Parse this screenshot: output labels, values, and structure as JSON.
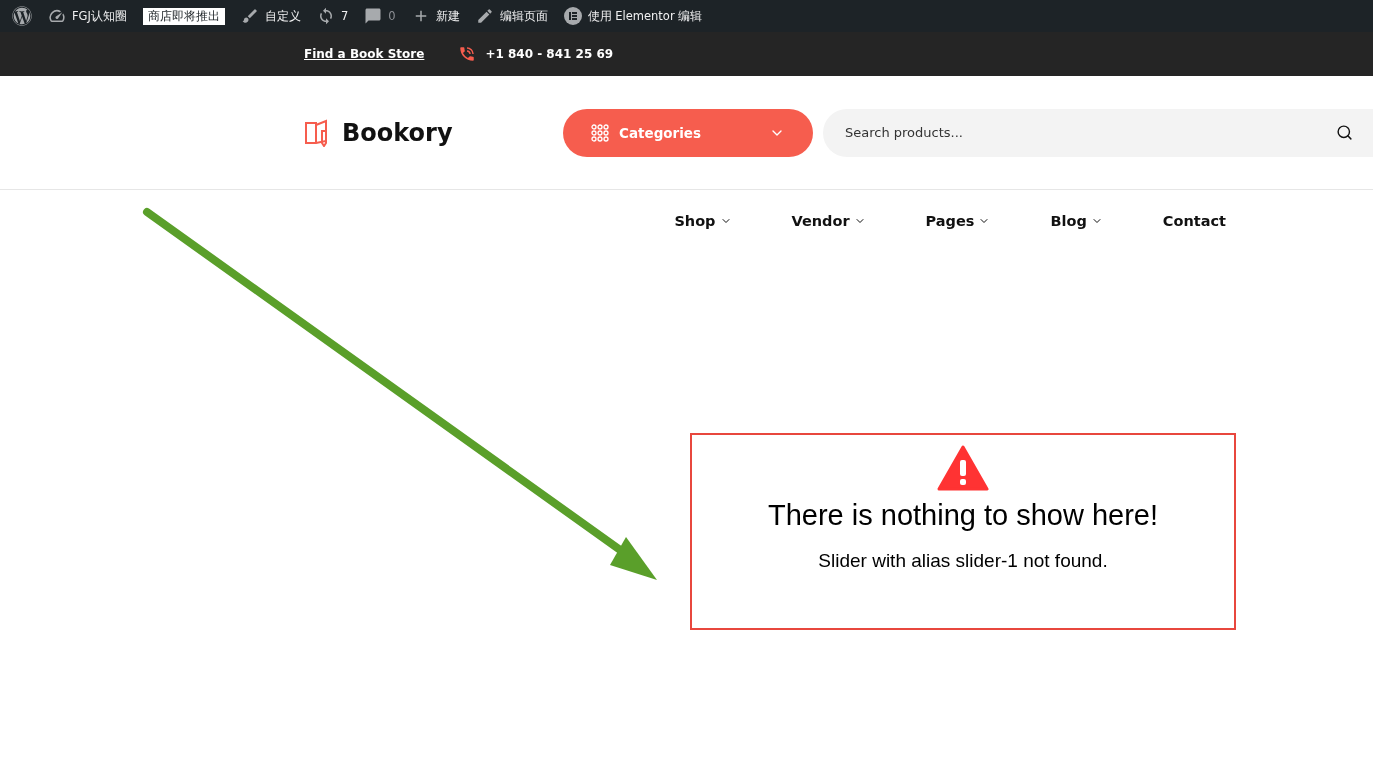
{
  "admin_bar": {
    "items": [
      {
        "kind": "wp"
      },
      {
        "kind": "dashboard",
        "label": "FGJ认知圈"
      },
      {
        "kind": "badge",
        "label": "商店即将推出"
      },
      {
        "kind": "brush",
        "label": "自定义"
      },
      {
        "kind": "updates",
        "label": "7"
      },
      {
        "kind": "comments",
        "label": "0",
        "disabled": true
      },
      {
        "kind": "new",
        "label": "新建"
      },
      {
        "kind": "edit",
        "label": "编辑页面"
      },
      {
        "kind": "elementor",
        "label": "使用 Elementor 编辑"
      }
    ]
  },
  "topbar": {
    "store_link": "Find a Book Store",
    "phone": "+1 840 - 841 25 69"
  },
  "header": {
    "logo": "Bookory",
    "categories": "Categories",
    "search": {
      "placeholder": "Search products..."
    }
  },
  "nav": [
    {
      "label": "Shop",
      "has_menu": true
    },
    {
      "label": "Vendor",
      "has_menu": true
    },
    {
      "label": "Pages",
      "has_menu": true
    },
    {
      "label": "Blog",
      "has_menu": true
    },
    {
      "label": "Contact",
      "has_menu": false
    }
  ],
  "error": {
    "title": "There is nothing to show here!",
    "message": "Slider with alias slider-1 not found."
  }
}
